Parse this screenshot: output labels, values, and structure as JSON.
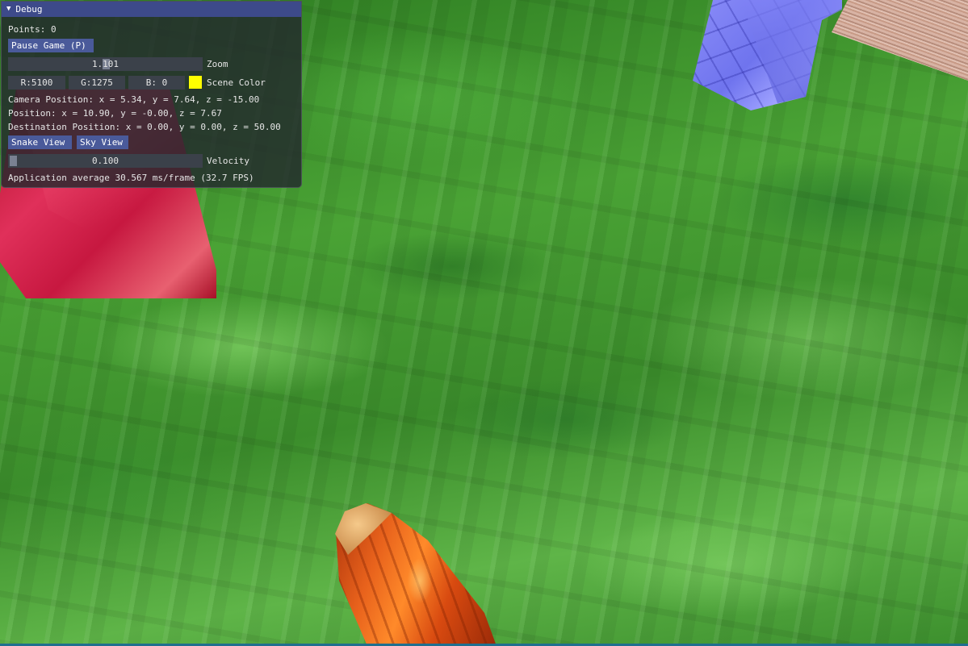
{
  "debug": {
    "title": "Debug",
    "points": "Points: 0",
    "pause_button": "Pause Game (P)",
    "zoom_value": "1.101",
    "zoom_label": "Zoom",
    "scene_color": {
      "r": "R:5100",
      "g": "G:1275",
      "b": "B:  0",
      "label": "Scene Color",
      "swatch_color": "#ffff00"
    },
    "camera_position": "Camera Position: x = 5.34, y = 7.64, z = -15.00",
    "position": "Position: x = 10.90, y = -0.00, z = 7.67",
    "destination_position": "Destination Position: x = 0.00, y = 0.00, z = 50.00",
    "snake_view_button": "Snake View",
    "sky_view_button": "Sky View",
    "velocity_value": "0.100",
    "velocity_label": "Velocity",
    "fps": "Application average 30.567 ms/frame (32.7 FPS)"
  },
  "colors": {
    "titlebar": "#3d4a8a",
    "button": "#4a5a9a",
    "window_bg": "#23282d"
  }
}
